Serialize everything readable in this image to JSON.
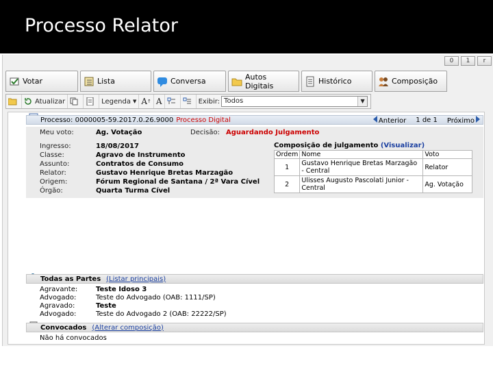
{
  "slide": {
    "title": "Processo Relator"
  },
  "window": {
    "controls": [
      "0",
      "1",
      "r"
    ]
  },
  "tabs": [
    {
      "label": "Votar",
      "icon": "vote-icon"
    },
    {
      "label": "Lista",
      "icon": "list-icon"
    },
    {
      "label": "Conversa",
      "icon": "chat-icon"
    },
    {
      "label": "Autos Digitais",
      "icon": "folder-icon"
    },
    {
      "label": "Histórico",
      "icon": "history-icon"
    },
    {
      "label": "Composição",
      "icon": "people-icon"
    }
  ],
  "toolbar": {
    "refresh_label": "Atualizar",
    "legend_label": "Legenda",
    "font_up": "A",
    "font_down": "A",
    "exibir_label": "Exibir:",
    "exibir_value": "Todos"
  },
  "process": {
    "label": "Processo:",
    "number": "0000005-59.2017.0.26.9000",
    "type": "Processo Digital",
    "nav_prev": "Anterior",
    "nav_page": "1 de 1",
    "nav_next": "Próximo"
  },
  "details": {
    "meu_voto_label": "Meu voto:",
    "meu_voto_value": "Ag. Votação",
    "decisao_label": "Decisão:",
    "decisao_value": "Aguardando Julgamento",
    "fields": [
      {
        "label": "Ingresso:",
        "value": "18/08/2017"
      },
      {
        "label": "Classe:",
        "value": "Agravo de Instrumento"
      },
      {
        "label": "Assunto:",
        "value": "Contratos de Consumo"
      },
      {
        "label": "Relator:",
        "value": "Gustavo Henrique Bretas Marzagão"
      },
      {
        "label": "Origem:",
        "value": "Fórum Regional de Santana / 2ª Vara Cível"
      },
      {
        "label": "Órgão:",
        "value": "Quarta Turma Cível"
      }
    ]
  },
  "composicao": {
    "title": "Composição de julgamento",
    "link": "(Visualizar)",
    "headers": [
      "Ordem",
      "Nome",
      "Voto"
    ],
    "rows": [
      {
        "ordem": "1",
        "nome": "Gustavo Henrique Bretas Marzagão - Central",
        "voto": "Relator"
      },
      {
        "ordem": "2",
        "nome": "Ulisses Augusto Pascolati Junior - Central",
        "voto": "Ag. Votação"
      }
    ]
  },
  "partes": {
    "title": "Todas as Partes",
    "link": "(Listar principais)",
    "rows": [
      {
        "label": "Agravante:",
        "value": "Teste Idoso 3",
        "bold": true
      },
      {
        "label": "Advogado:",
        "value": "Teste do Advogado (OAB: 1111/SP)",
        "bold": false
      },
      {
        "label": "Agravado:",
        "value": "Teste",
        "bold": true
      },
      {
        "label": "Advogado:",
        "value": "Teste do Advogado 2 (OAB: 22222/SP)",
        "bold": false
      }
    ]
  },
  "convocados": {
    "title": "Convocados",
    "link": "(Alterar composição)",
    "empty": "Não há convocados"
  }
}
